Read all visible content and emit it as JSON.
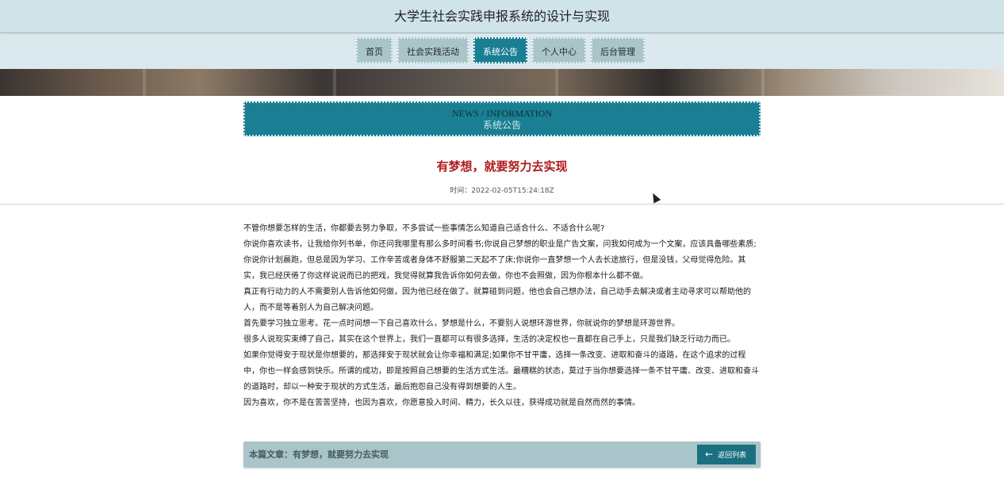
{
  "header": {
    "title": "大学生社会实践申报系统的设计与实现"
  },
  "nav": {
    "items": [
      {
        "label": "首页"
      },
      {
        "label": "社会实践活动"
      },
      {
        "label": "系统公告"
      },
      {
        "label": "个人中心"
      },
      {
        "label": "后台管理"
      }
    ],
    "active_index": 2
  },
  "section": {
    "title_en": "NEWS / INFORMATION",
    "title_cn": "系统公告"
  },
  "article": {
    "title": "有梦想，就要努力去实现",
    "time": "时间：2022-02-05T15:24:18Z",
    "paragraphs": [
      "不管你想要怎样的生活，你都要去努力争取，不多尝试一些事情怎么知道自己适合什么、不适合什么呢?",
      "你说你喜欢读书，让我给你列书单，你还问我哪里有那么多时间看书;你说自己梦想的职业是广告文案，问我如何成为一个文案，应该具备哪些素质;你说你计划晨跑，但总是因为学习、工作辛苦或者身体不舒服第二天起不了床;你说你一直梦想一个人去长途旅行，但是没钱，父母觉得危险。其实，我已经厌倦了你这样说说而已的把戏，我觉得就算我告诉你如何去做，你也不会照做，因为你根本什么都不做。",
      "真正有行动力的人不需要别人告诉他如何做，因为他已经在做了。就算碰到问题，他也会自己想办法，自己动手去解决或者主动寻求可以帮助他的人，而不是等着别人为自己解决问题。",
      "首先要学习独立思考。花一点时间想一下自己喜欢什么，梦想是什么，不要别人说想环游世界，你就说你的梦想是环游世界。",
      "很多人说现实束缚了自己，其实在这个世界上，我们一直都可以有很多选择，生活的决定权也一直都在自己手上，只是我们缺乏行动力而已。",
      "如果你觉得安于现状是你想要的，那选择安于现状就会让你幸福和满足;如果你不甘平庸，选择一条改变、进取和奋斗的道路，在这个追求的过程中，你也一样会感到快乐。所谓的成功，即是按照自己想要的生活方式生活。最糟糕的状态，莫过于当你想要选择一条不甘平庸、改变、进取和奋斗的道路时，却以一种安于现状的方式生活，最后抱怨自己没有得到想要的人生。",
      "因为喜欢，你不是在苦苦坚持，也因为喜欢，你愿意投入时间、精力，长久以往，获得成功就是自然而然的事情。"
    ]
  },
  "footer": {
    "current_label": "本篇文章：有梦想，就要努力去实现",
    "back_label": "返回列表",
    "back_icon": "arrow-left-icon"
  },
  "colors": {
    "accent": "#1a7f92",
    "nav_bg": "#a9c5c9",
    "title_red": "#b01a1a"
  }
}
